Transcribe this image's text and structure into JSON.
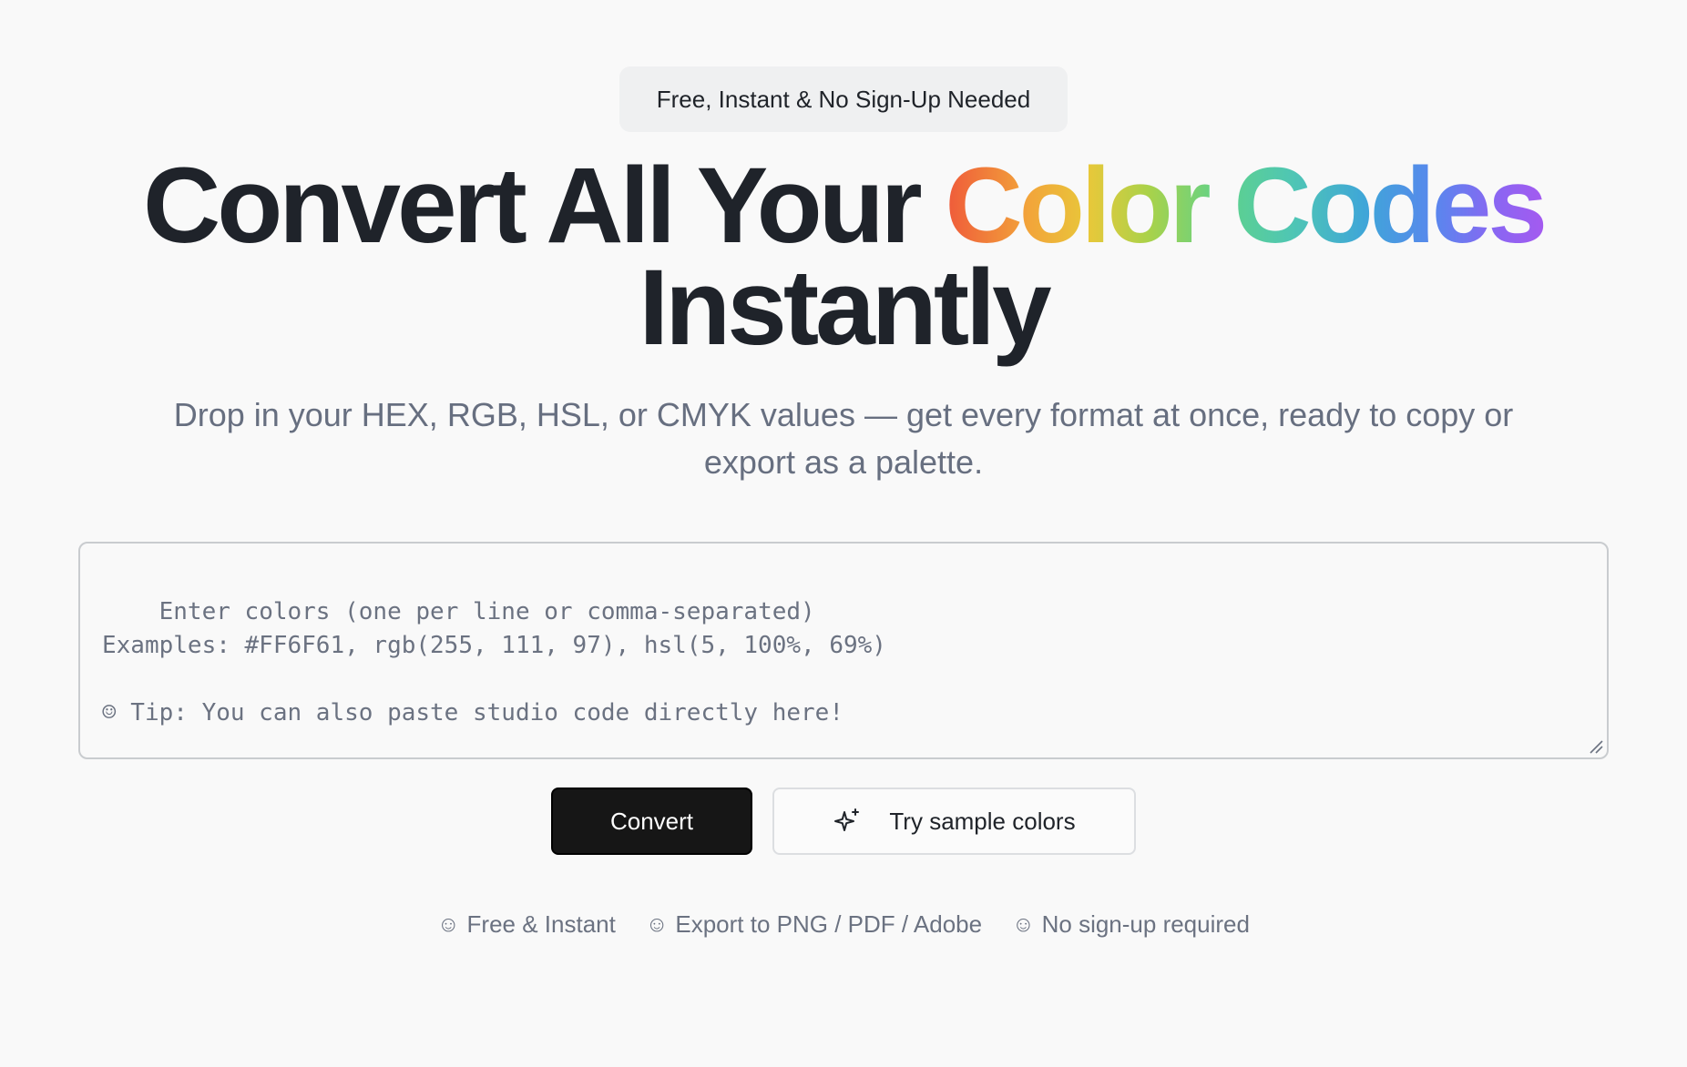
{
  "badge": {
    "text": "Free, Instant & No Sign-Up Needed"
  },
  "hero": {
    "title_part1": "Convert All Your ",
    "title_gradient": "Color Codes",
    "title_line2": "Instantly",
    "subtitle": "Drop in your HEX, RGB, HSL, or CMYK values — get every format at once, ready to copy or export as a palette.",
    "gradient_colors": [
      "#ef5a3a",
      "#f2a53a",
      "#e8c83a",
      "#a9d24a",
      "#5fd28a",
      "#4fc6b4",
      "#3fa6d8",
      "#5a86ee",
      "#8a66f2",
      "#a45af0"
    ]
  },
  "input": {
    "placeholder": "Enter colors (one per line or comma-separated)\nExamples: #FF6F61, rgb(255, 111, 97), hsl(5, 100%, 69%)\n\n☺ Tip: You can also paste studio code directly here!",
    "value": ""
  },
  "actions": {
    "convert_label": "Convert",
    "sample_label": "Try sample colors",
    "sample_icon": "sparkle-icon"
  },
  "features": [
    {
      "icon": "☺",
      "label": "Free & Instant"
    },
    {
      "icon": "☺",
      "label": "Export to PNG / PDF / Adobe"
    },
    {
      "icon": "☺",
      "label": "No sign-up required"
    }
  ],
  "colors": {
    "background": "#f9f9f9",
    "primary_button": "#161616",
    "heading": "#1f232a",
    "muted_text": "#6b7281"
  }
}
